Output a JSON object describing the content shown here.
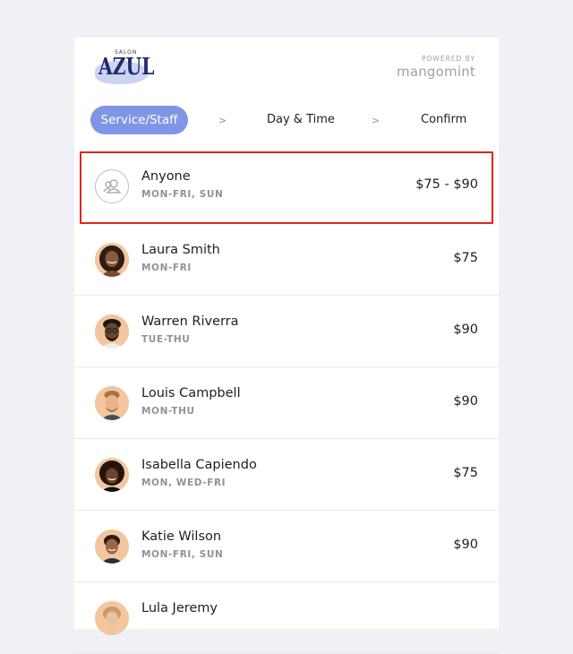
{
  "brand": {
    "logo_small": "SALON",
    "logo_main": "AZUL",
    "powered_label": "POWERED BY",
    "powered_brand": "mangomint"
  },
  "steps": {
    "active": "Service/Staff",
    "separator": ">",
    "day_time": "Day & Time",
    "confirm": "Confirm"
  },
  "staff": [
    {
      "name": "Anyone",
      "days": "MON-FRI, SUN",
      "price": "$75 - $90",
      "selected": true,
      "icon": "group-icon"
    },
    {
      "name": "Laura Smith",
      "days": "MON-FRI",
      "price": "$75"
    },
    {
      "name": "Warren Riverra",
      "days": "TUE-THU",
      "price": "$90"
    },
    {
      "name": "Louis Campbell",
      "days": "MON-THU",
      "price": "$90"
    },
    {
      "name": "Isabella Capiendo",
      "days": "MON, WED-FRI",
      "price": "$75"
    },
    {
      "name": "Katie Wilson",
      "days": "MON-FRI, SUN",
      "price": "$90"
    },
    {
      "name": "Lula Jeremy",
      "days": "",
      "price": ""
    }
  ],
  "colors": {
    "accent": "#7f96e6",
    "selection_border": "#e1251b",
    "logo_navy": "#1f2b6e"
  }
}
